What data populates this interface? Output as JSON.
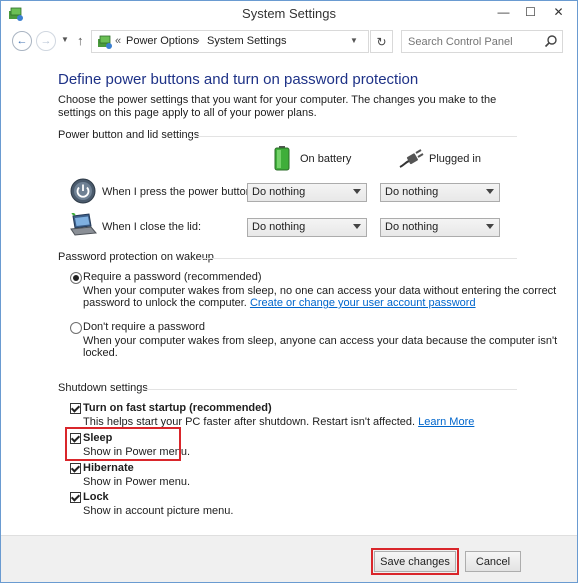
{
  "window": {
    "title": "System Settings",
    "minimize": "—",
    "maximize": "☐",
    "close": "✕"
  },
  "navbar": {
    "back": "←",
    "forward": "→",
    "history": "▼",
    "up": "↑",
    "breadcrumb_sep": "«",
    "crumbs": [
      "Power Options",
      "System Settings"
    ],
    "crumb_arrow": "›",
    "refresh": "↻",
    "search_placeholder": "Search Control Panel"
  },
  "page": {
    "heading": "Define power buttons and turn on password protection",
    "intro": "Choose the power settings that you want for your computer. The changes you make to the settings on this page apply to all of your power plans."
  },
  "power_buttons": {
    "section_label": "Power button and lid settings",
    "col_battery": "On battery",
    "col_plugged": "Plugged in",
    "rows": [
      {
        "label": "When I press the power button:",
        "battery": "Do nothing",
        "plugged": "Do nothing"
      },
      {
        "label": "When I close the lid:",
        "battery": "Do nothing",
        "plugged": "Do nothing"
      }
    ]
  },
  "password": {
    "section_label": "Password protection on wakeup",
    "require_label": "Require a password (recommended)",
    "require_desc_1": "When your computer wakes from sleep, no one can access your data without entering the correct",
    "require_desc_2": "password to unlock the computer.",
    "require_link": "Create or change your user account password",
    "norequire_label": "Don't require a password",
    "norequire_desc_1": "When your computer wakes from sleep, anyone can access your data because the computer isn't",
    "norequire_desc_2": "locked."
  },
  "shutdown": {
    "section_label": "Shutdown settings",
    "items": [
      {
        "label": "Turn on fast startup (recommended)",
        "desc": "This helps start your PC faster after shutdown. Restart isn't affected.",
        "link": "Learn More",
        "checked": true
      },
      {
        "label": "Sleep",
        "desc": "Show in Power menu.",
        "checked": true
      },
      {
        "label": "Hibernate",
        "desc": "Show in Power menu.",
        "checked": true
      },
      {
        "label": "Lock",
        "desc": "Show in account picture menu.",
        "checked": true
      }
    ]
  },
  "footer": {
    "save": "Save changes",
    "cancel": "Cancel"
  },
  "colors": {
    "heading": "#1e3287",
    "link": "#0066cc",
    "highlight": "#d9262b"
  }
}
